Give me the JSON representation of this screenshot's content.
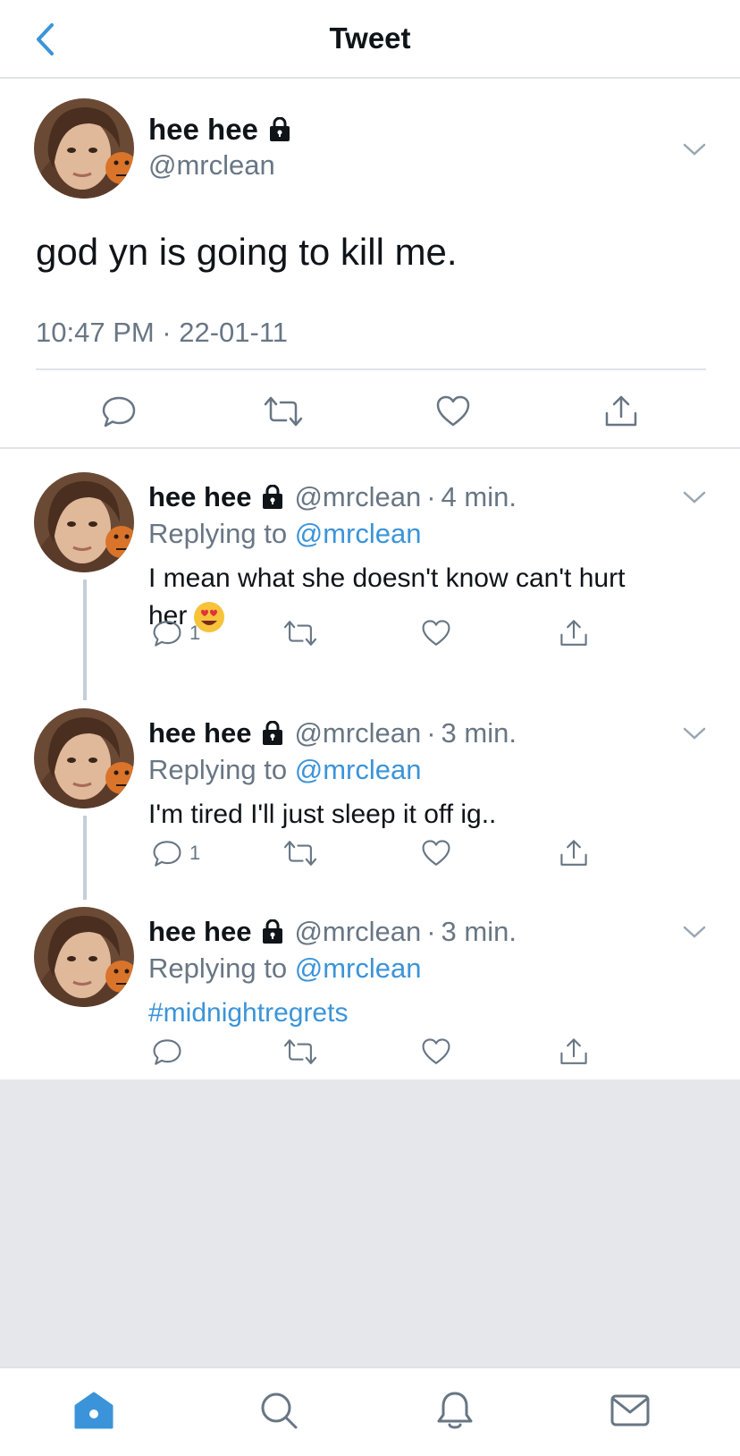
{
  "header": {
    "title": "Tweet"
  },
  "main_tweet": {
    "name": "hee hee",
    "handle": "@mrclean",
    "text": "god yn is going to kill me.",
    "time": "10:47 PM · 22-01-11"
  },
  "replies": [
    {
      "name": "hee hee",
      "handle": "@mrclean",
      "time": "4 min.",
      "replying_prefix": "Replying to",
      "replying_to": "@mrclean",
      "text_line1": "I mean what she doesn't know can't hurt",
      "text_line2": "her",
      "reply_count": "1"
    },
    {
      "name": "hee hee",
      "handle": "@mrclean",
      "time": "3 min.",
      "replying_prefix": "Replying to",
      "replying_to": "@mrclean",
      "text": "I'm tired I'll just sleep it off ig..",
      "reply_count": "1"
    },
    {
      "name": "hee hee",
      "handle": "@mrclean",
      "time": "3 min.",
      "replying_prefix": "Replying to",
      "replying_to": "@mrclean",
      "text": "#midnightregrets"
    }
  ],
  "colors": {
    "accent": "#3b94d9",
    "muted": "#687684",
    "divider": "#dfe3e8",
    "empty_bg": "#e6e7eb"
  },
  "icons": [
    "back-chevron-icon",
    "lock-icon",
    "chevron-down-icon",
    "reply-icon",
    "retweet-icon",
    "like-icon",
    "share-icon",
    "home-icon",
    "search-icon",
    "bell-icon",
    "mail-icon"
  ]
}
